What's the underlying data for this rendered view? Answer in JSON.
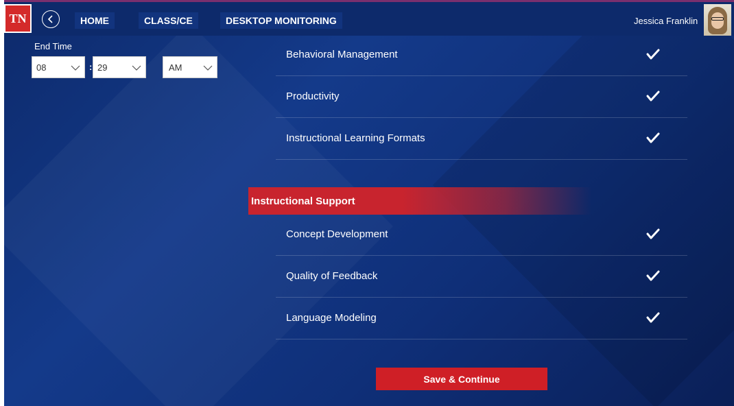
{
  "header": {
    "logo_text": "TN",
    "nav": {
      "home": "HOME",
      "class_ce": "CLASS/CE",
      "desktop_monitoring": "DESKTOP MONITORING"
    },
    "user_name": "Jessica Franklin"
  },
  "end_time": {
    "label": "End Time",
    "hour": "08",
    "minute": "29",
    "period": "AM",
    "separator": ":"
  },
  "section1": {
    "items": [
      {
        "label": "Behavioral Management",
        "checked": true
      },
      {
        "label": "Productivity",
        "checked": true
      },
      {
        "label": "Instructional Learning Formats",
        "checked": true
      }
    ]
  },
  "section2": {
    "title": "Instructional Support",
    "items": [
      {
        "label": "Concept Development",
        "checked": true
      },
      {
        "label": "Quality of Feedback",
        "checked": true
      },
      {
        "label": "Language Modeling",
        "checked": true
      }
    ]
  },
  "actions": {
    "save_label": "Save & Continue"
  },
  "colors": {
    "background": "#143a8a",
    "topbar": "#0d2a6b",
    "accent_red": "#cf1f26",
    "logo_red": "#d42a2a",
    "text": "#ffffff"
  },
  "icons": {
    "back": "back-circle-icon",
    "check": "checkmark-icon",
    "dropdown": "chevron-down-icon"
  }
}
